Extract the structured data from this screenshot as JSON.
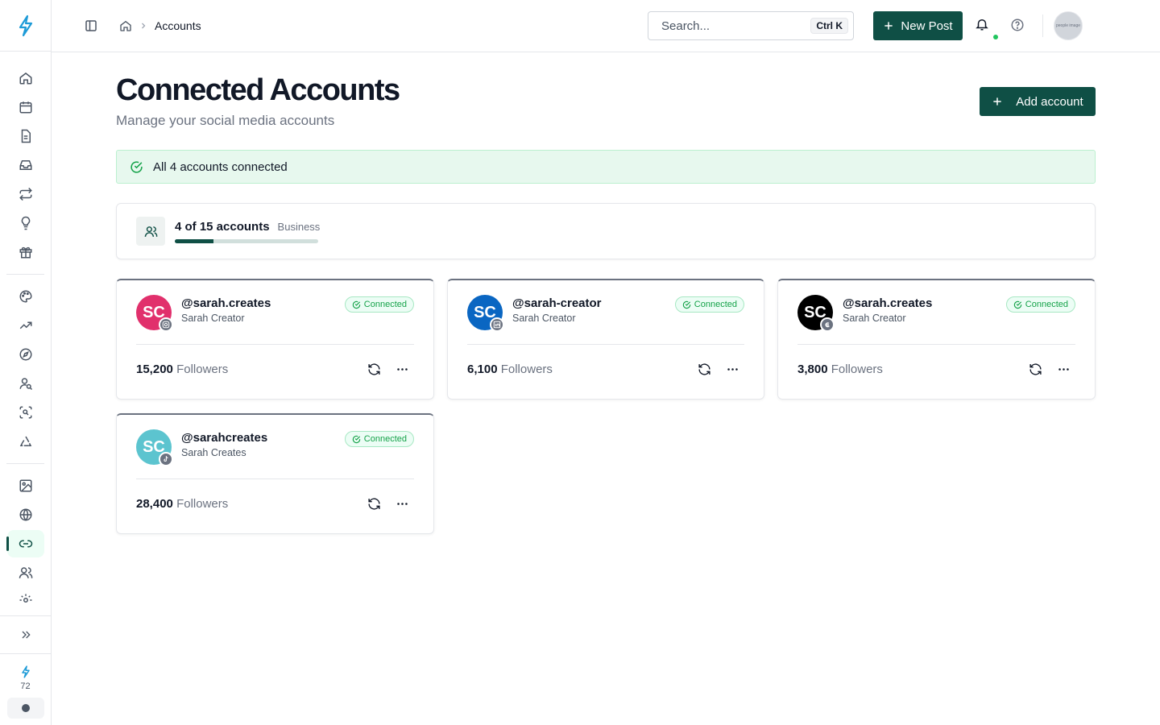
{
  "breadcrumb": {
    "current": "Accounts"
  },
  "search": {
    "placeholder": "Search...",
    "shortcut": "Ctrl K"
  },
  "header": {
    "new_post_label": "New Post",
    "avatar_text": "people image"
  },
  "sidebar": {
    "credits_count": "72"
  },
  "page": {
    "title": "Connected Accounts",
    "subtitle": "Manage your social media accounts",
    "add_account_label": "Add account"
  },
  "banner": {
    "text": "All 4 accounts connected"
  },
  "usage": {
    "count_text": "4 of 15 accounts",
    "plan": "Business",
    "progress_fraction": 0.267
  },
  "accounts": [
    {
      "initials": "SC",
      "handle": "@sarah.creates",
      "name": "Sarah Creator",
      "status": "Connected",
      "followers_count": "15,200",
      "followers_label": "Followers",
      "platform": "instagram-icon",
      "avatar_color": "#e1306c"
    },
    {
      "initials": "SC",
      "handle": "@sarah-creator",
      "name": "Sarah Creator",
      "status": "Connected",
      "followers_count": "6,100",
      "followers_label": "Followers",
      "platform": "linkedin-icon",
      "avatar_color": "#0a66c2"
    },
    {
      "initials": "SC",
      "handle": "@sarah.creates",
      "name": "Sarah Creator",
      "status": "Connected",
      "followers_count": "3,800",
      "followers_label": "Followers",
      "platform": "threads-icon",
      "avatar_color": "#000000"
    },
    {
      "initials": "SC",
      "handle": "@sarahcreates",
      "name": "Sarah Creates",
      "status": "Connected",
      "followers_count": "28,400",
      "followers_label": "Followers",
      "platform": "tiktok-icon",
      "avatar_color": "#5cc4cf"
    }
  ],
  "colors": {
    "brand": "#0f4f45",
    "success": "#16a34a",
    "success_bg": "#e7f8ee"
  }
}
